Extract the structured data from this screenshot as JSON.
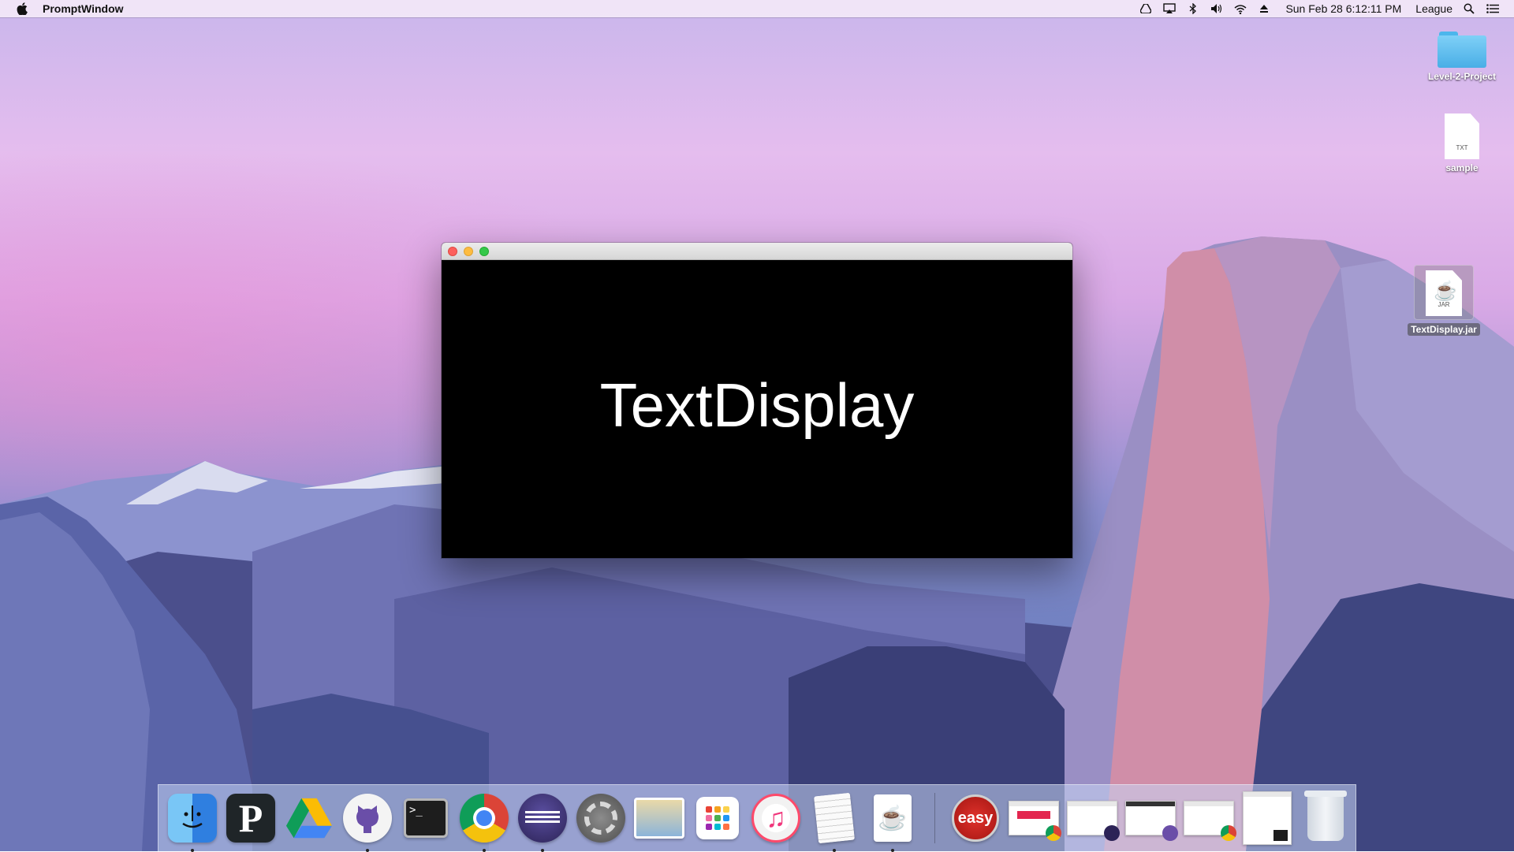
{
  "menubar": {
    "app_name": "PromptWindow",
    "clock": "Sun Feb 28  6:12:11 PM",
    "user": "League",
    "status_icons": [
      "drive-icon",
      "airplay-icon",
      "bluetooth-icon",
      "volume-icon",
      "wifi-icon",
      "eject-icon"
    ]
  },
  "desktop_icons": {
    "folder_label": "Level-2-Project",
    "txt_label": "sample",
    "txt_badge": "TXT",
    "jar_label": "TextDisplay.jar",
    "jar_badge": "JAR"
  },
  "window": {
    "display_text": "TextDisplay"
  },
  "dock": {
    "pycharm_letter": "P",
    "terminal_prompt": ">_",
    "itunes_glyph": "♫",
    "java_glyph": "☕",
    "easy_text": "easy",
    "apps": [
      "finder-icon",
      "pycharm-icon",
      "google-drive-icon",
      "github-icon",
      "terminal-icon",
      "chrome-icon",
      "eclipse-icon",
      "system-preferences-icon",
      "preview-icon",
      "launchpad-icon",
      "itunes-icon",
      "textedit-icon",
      "java-icon"
    ],
    "right_items": [
      "easy-icon",
      "window-thumbnail-chrome",
      "window-thumbnail-eclipse",
      "window-thumbnail-github",
      "window-thumbnail-chrome-2",
      "window-thumbnail-terminal",
      "trash-icon"
    ]
  }
}
